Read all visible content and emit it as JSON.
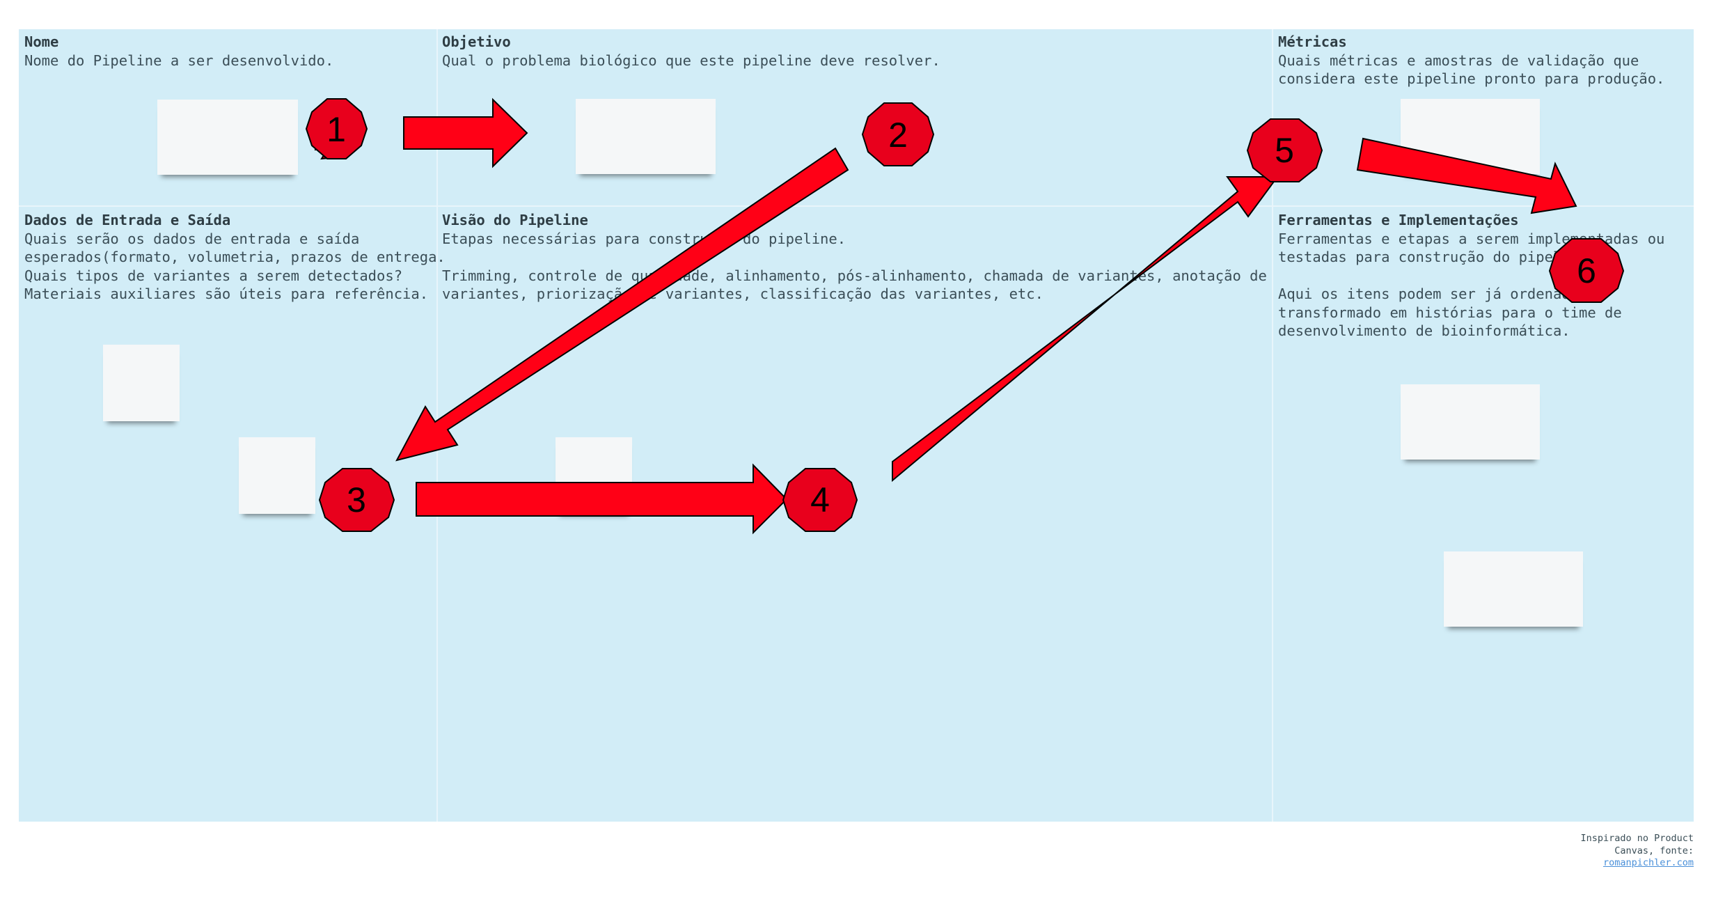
{
  "sections": {
    "nome": {
      "title": "Nome",
      "text": "Nome do Pipeline a ser desenvolvido."
    },
    "objetivo": {
      "title": "Objetivo",
      "text": "Qual o problema biológico que este pipeline deve resolver."
    },
    "metricas": {
      "title": "Métricas",
      "text": "Quais métricas e amostras de validação que\nconsidera este pipeline pronto para produção."
    },
    "dados": {
      "title": "Dados de Entrada e Saída",
      "text": "Quais serão os dados de entrada e saída\nesperados(formato, volumetria, prazos de entrega.\nQuais tipos de variantes a serem detectados?\nMateriais auxiliares são úteis para referência."
    },
    "visao": {
      "title": "Visão do Pipeline",
      "text": "Etapas necessárias para construção do pipeline.\n\nTrimming, controle de qualidade, alinhamento, pós-alinhamento, chamada de variantes, anotação de\nvariantes, priorização de variantes, classificação das variantes, etc."
    },
    "ferramentas": {
      "title": "Ferramentas e Implementações",
      "text": "Ferramentas e etapas a serem implementadas ou\ntestadas para construção do pipeline.\n\nAqui os itens podem ser já ordenados e\ntransformado em histórias para o time de\ndesenvolvimento de bioinformática."
    }
  },
  "badges": [
    "1",
    "2",
    "3",
    "4",
    "5",
    "6"
  ],
  "footer": {
    "line1": "Inspirado no Product",
    "line2": "Canvas, fonte:",
    "link": "romanpichler.com"
  },
  "colors": {
    "canvas": "#d2edf7",
    "arrow": "#ff0016",
    "badge": "#e8001c",
    "note": "#f5f7f8"
  }
}
